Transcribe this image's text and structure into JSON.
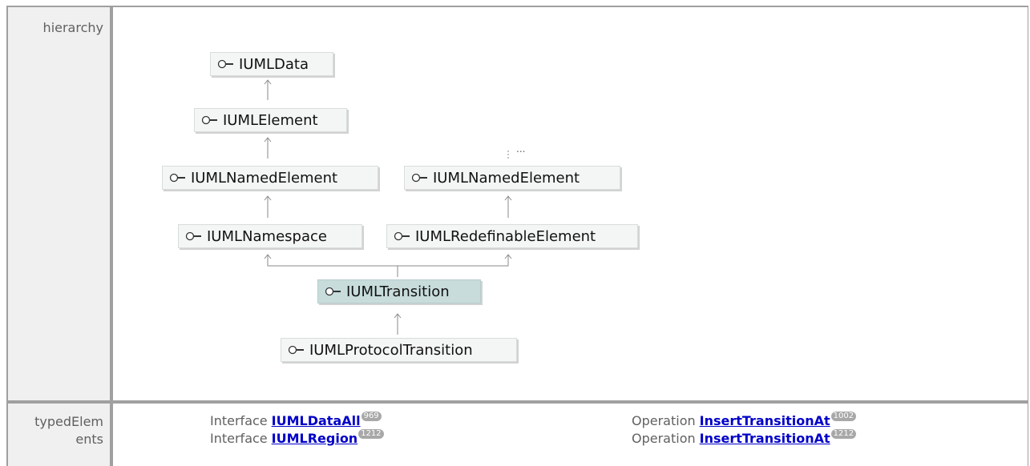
{
  "rows": {
    "hierarchy_label": "hierarchy",
    "typed_elements_label_line1": "typedElem",
    "typed_elements_label_line2": "ents"
  },
  "diagram": {
    "nodes": {
      "umldata": "IUMLData",
      "umlelement": "IUMLElement",
      "namedelement_left": "IUMLNamedElement",
      "namedelement_right": "IUMLNamedElement",
      "namespace": "IUMLNamespace",
      "redefinable": "IUMLRedefinableElement",
      "transition": "IUMLTransition",
      "protocoltransition": "IUMLProtocolTransition"
    },
    "more_indicator": "...",
    "selected_node": "IUMLTransition",
    "icon": "interface-lollipop-icon"
  },
  "typed_elements": [
    {
      "kind": "Interface",
      "name": "IUMLDataAll",
      "count": "969"
    },
    {
      "kind": "Interface",
      "name": "IUMLRegion",
      "count": "1212"
    },
    {
      "kind": "Operation",
      "name": "InsertTransitionAt",
      "count": "1002"
    },
    {
      "kind": "Operation",
      "name": "InsertTransitionAt",
      "count": "1212"
    }
  ],
  "colors": {
    "link": "#0000c8",
    "node_fill": "#f3f6f5",
    "selected_fill": "#c8dcdc",
    "badge": "#a8a8a8",
    "label_gray": "#606060"
  }
}
